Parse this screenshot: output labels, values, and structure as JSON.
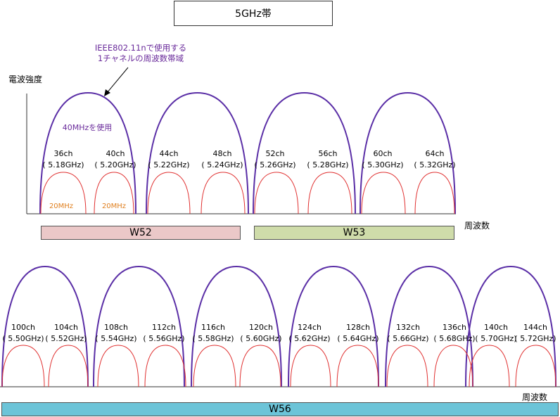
{
  "title": "5GHz帯",
  "annotation": {
    "line1": "IEEE802.11nで使用する",
    "line2": "1チャネルの周波数帯域"
  },
  "y_axis_label": "電波強度",
  "x_axis_label_top": "周波数",
  "x_axis_label_bottom": "周波数",
  "wide_label": "40MHzを使用",
  "narrow_label": "20MHz",
  "colors": {
    "wide_arc": "#5a2ea6",
    "narrow_arc": "#e03030",
    "narrow_label": "#e08020",
    "annotation": "#6a2b9b",
    "w52": "#ebc8c8",
    "w53": "#cfdcaa",
    "w56": "#6cc4d8"
  },
  "top_row": {
    "channels": [
      {
        "ch": "36ch",
        "freq": "( 5.18GHz)"
      },
      {
        "ch": "40ch",
        "freq": "( 5.20GHz)"
      },
      {
        "ch": "44ch",
        "freq": "( 5.22GHz)"
      },
      {
        "ch": "48ch",
        "freq": "( 5.24GHz)"
      },
      {
        "ch": "52ch",
        "freq": "( 5.26GHz)"
      },
      {
        "ch": "56ch",
        "freq": "( 5.28GHz)"
      },
      {
        "ch": "60ch",
        "freq": "( 5.30GHz)"
      },
      {
        "ch": "64ch",
        "freq": "( 5.32GHz)"
      }
    ],
    "bands": [
      {
        "name": "W52"
      },
      {
        "name": "W53"
      }
    ]
  },
  "bottom_row": {
    "channels": [
      {
        "ch": "100ch",
        "freq": "( 5.50GHz)"
      },
      {
        "ch": "104ch",
        "freq": "( 5.52GHz)"
      },
      {
        "ch": "108ch",
        "freq": "( 5.54GHz)"
      },
      {
        "ch": "112ch",
        "freq": "( 5.56GHz)"
      },
      {
        "ch": "116ch",
        "freq": "( 5.58GHz)"
      },
      {
        "ch": "120ch",
        "freq": "( 5.60GHz)"
      },
      {
        "ch": "124ch",
        "freq": "( 5.62GHz)"
      },
      {
        "ch": "128ch",
        "freq": "( 5.64GHz)"
      },
      {
        "ch": "132ch",
        "freq": "( 5.66GHz)"
      },
      {
        "ch": "136ch",
        "freq": "( 5.68GHz)"
      },
      {
        "ch": "140ch",
        "freq": "( 5.70GHz)"
      },
      {
        "ch": "144ch",
        "freq": "( 5.72GHz)"
      }
    ],
    "bands": [
      {
        "name": "W56"
      }
    ]
  }
}
